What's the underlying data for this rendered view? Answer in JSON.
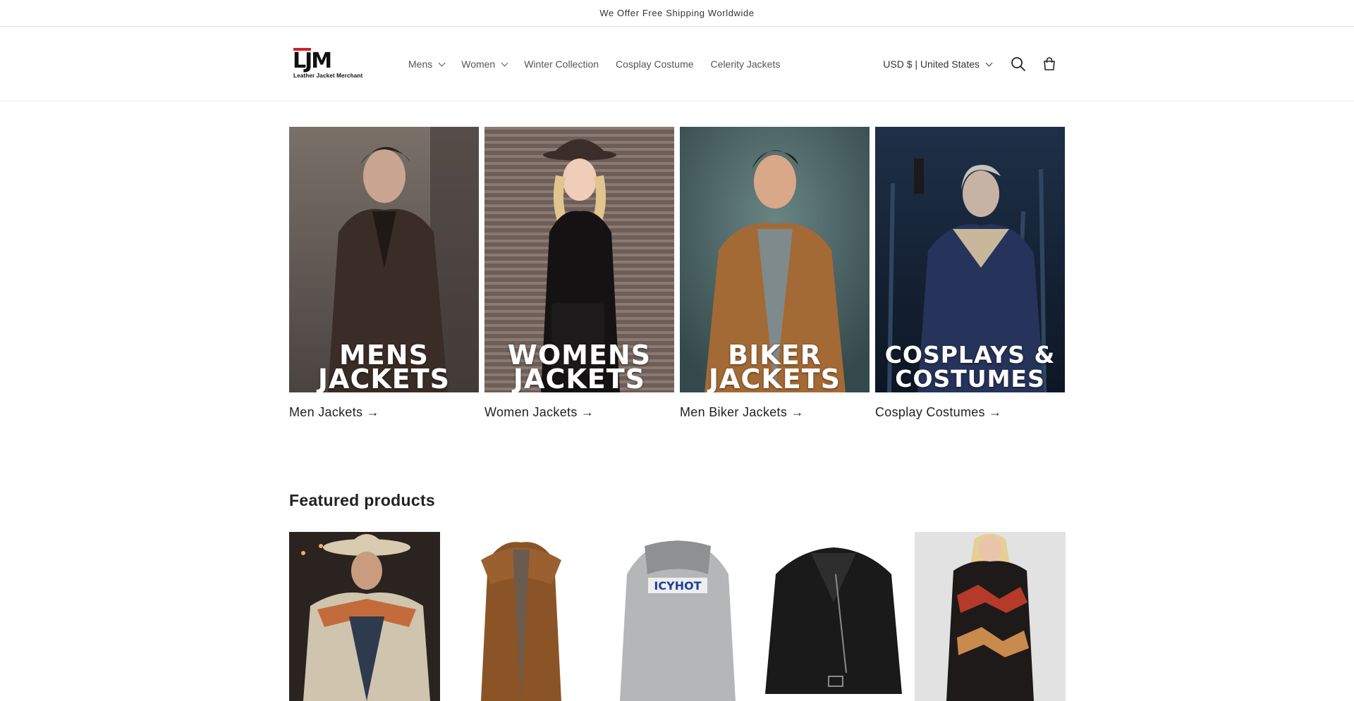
{
  "announcement": {
    "text": "We Offer Free Shipping Worldwide"
  },
  "logo": {
    "mark": "LJM",
    "tagline": "Leather Jacket Merchant"
  },
  "nav": {
    "items": [
      {
        "label": "Mens",
        "dropdown": true
      },
      {
        "label": "Women",
        "dropdown": true
      },
      {
        "label": "Winter Collection",
        "dropdown": false
      },
      {
        "label": "Cosplay Costume",
        "dropdown": false
      },
      {
        "label": "Celerity Jackets",
        "dropdown": false
      }
    ]
  },
  "header": {
    "currency": "USD $ | United States"
  },
  "icons": {
    "search": "search-icon",
    "cart": "cart-icon"
  },
  "collections": [
    {
      "overlay_line1": "MENS",
      "overlay_line2": "JACKETS",
      "link": "Men Jackets →"
    },
    {
      "overlay_line1": "WOMENS",
      "overlay_line2": "JACKETS",
      "link": "Women Jackets →"
    },
    {
      "overlay_line1": "BIKER",
      "overlay_line2": "JACKETS",
      "link": "Men Biker Jackets →"
    },
    {
      "overlay_line1": "COSPLAYS &",
      "overlay_line2": "COSTUMES",
      "link": "Cosplay Costumes →"
    }
  ],
  "featured": {
    "title": "Featured products"
  },
  "colors": {
    "accent": "#d32121",
    "text": "#121212",
    "muted": "#555555"
  }
}
